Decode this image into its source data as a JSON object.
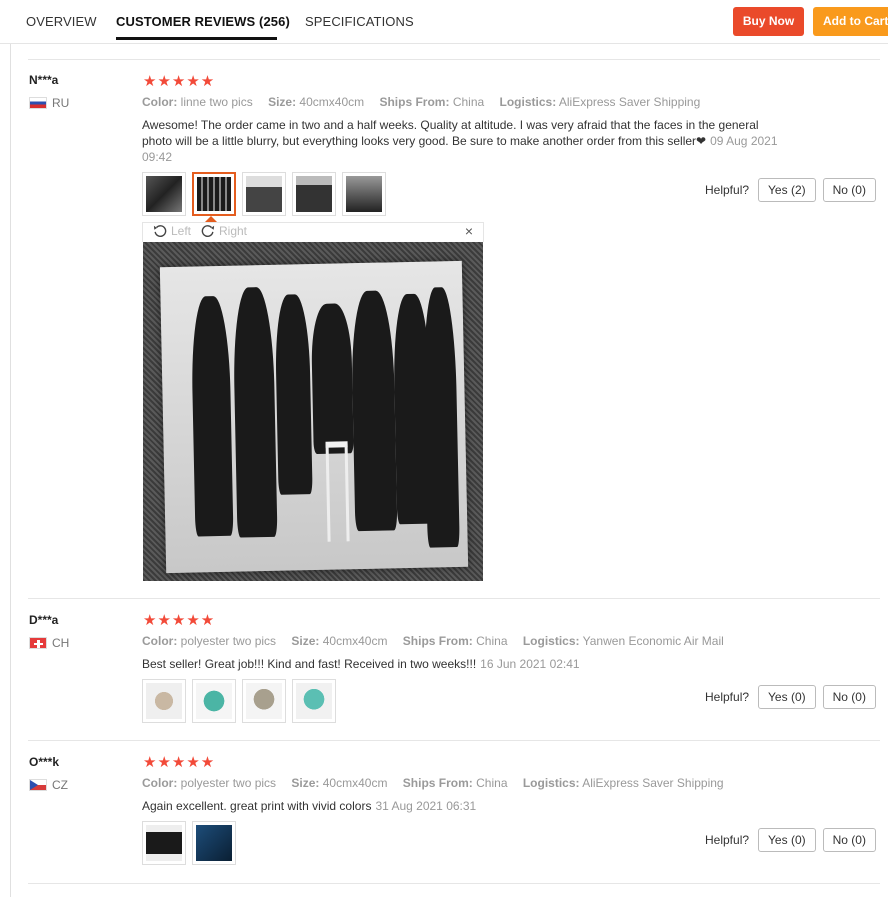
{
  "tabs": [
    {
      "label": "OVERVIEW"
    },
    {
      "label": "CUSTOMER REVIEWS (256)"
    },
    {
      "label": "SPECIFICATIONS"
    }
  ],
  "actions": {
    "buy_now": "Buy Now",
    "add_to_cart": "Add to Cart"
  },
  "labels": {
    "color": "Color:",
    "size": "Size:",
    "ships_from": "Ships From:",
    "logistics": "Logistics:",
    "helpful": "Helpful?"
  },
  "viewer": {
    "left": "Left",
    "right": "Right",
    "close": "×"
  },
  "reviews": [
    {
      "user": "N***a",
      "country": "RU",
      "rating": 5,
      "stars": "★★★★★",
      "color": "linne two pics",
      "size": "40cmx40cm",
      "ships_from": "China",
      "logistics": "AliExpress Saver Shipping",
      "text": "Awesome! The order came in two and a half weeks. Quality at altitude. I was very afraid that the faces in the general photo will be a little blurry, but everything looks very good. Be sure to make another order from this seller❤",
      "date": "09 Aug 2021 09:42",
      "yes": "Yes (2)",
      "no": "No (0)"
    },
    {
      "user": "D***a",
      "country": "CH",
      "rating": 5,
      "stars": "★★★★★",
      "color": "polyester two pics",
      "size": "40cmx40cm",
      "ships_from": "China",
      "logistics": "Yanwen Economic Air Mail",
      "text": "Best seller! Great job!!! Kind and fast! Received in two weeks!!!",
      "date": "16 Jun 2021 02:41",
      "yes": "Yes (0)",
      "no": "No (0)"
    },
    {
      "user": "O***k",
      "country": "CZ",
      "rating": 5,
      "stars": "★★★★★",
      "color": "polyester two pics",
      "size": "40cmx40cm",
      "ships_from": "China",
      "logistics": "AliExpress Saver Shipping",
      "text": "Again excellent. great print with vivid colors",
      "date": "31 Aug 2021 06:31",
      "yes": "Yes (0)",
      "no": "No (0)"
    }
  ]
}
